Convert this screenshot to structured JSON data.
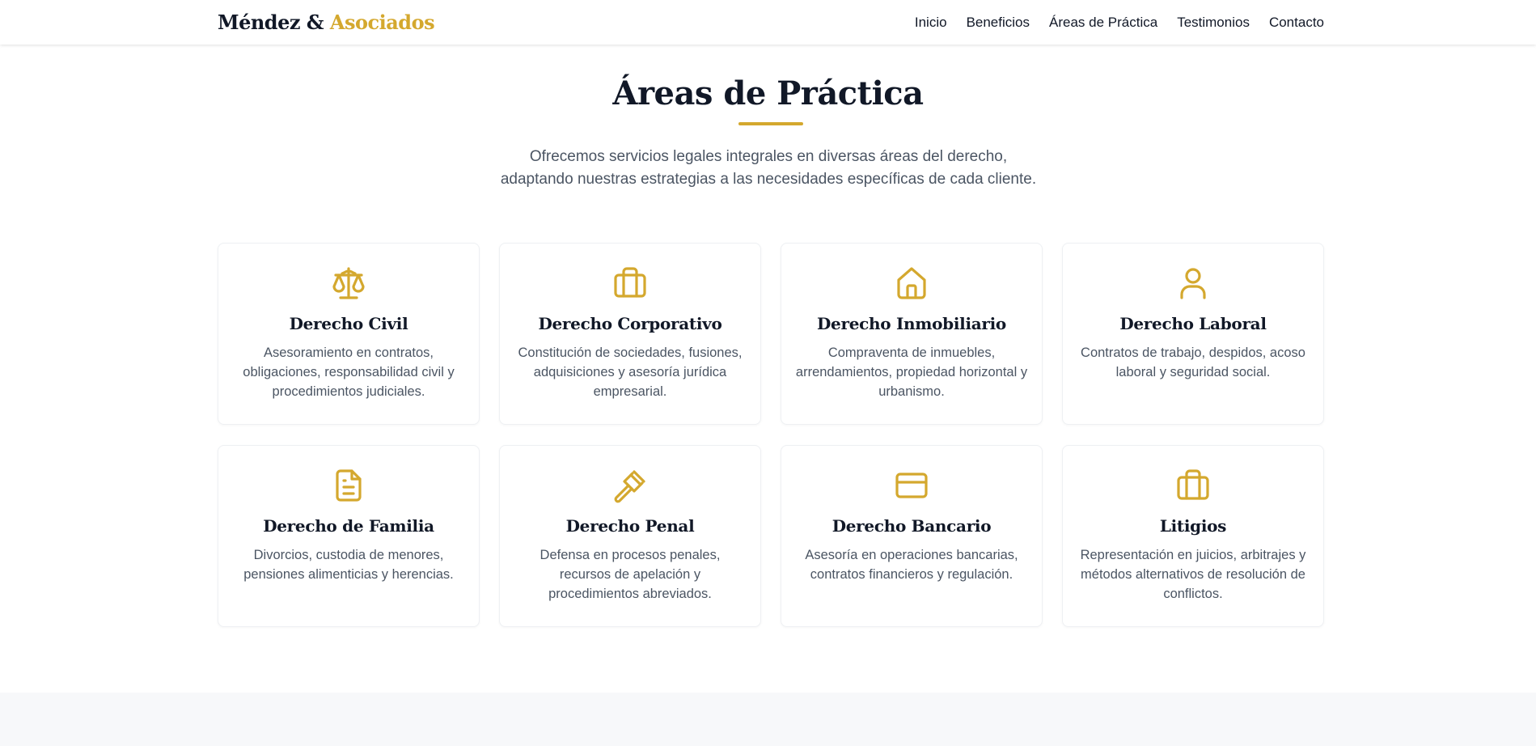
{
  "brand": {
    "name_part1": "Méndez &",
    "name_part2": "Asociados"
  },
  "nav": {
    "items": [
      "Inicio",
      "Beneficios",
      "Áreas de Práctica",
      "Testimonios",
      "Contacto"
    ]
  },
  "section": {
    "title": "Áreas de Práctica",
    "description_line1": "Ofrecemos servicios legales integrales en diversas áreas del derecho,",
    "description_line2": "adaptando nuestras estrategias a las necesidades específicas de cada cliente."
  },
  "colors": {
    "accent": "#d4a82e",
    "heading": "#111827",
    "body_text": "#4b5563"
  },
  "cards": [
    {
      "icon": "scale-icon",
      "title": "Derecho Civil",
      "text": "Asesoramiento en contratos, obligaciones, responsabilidad civil y procedimientos judiciales."
    },
    {
      "icon": "briefcase-icon",
      "title": "Derecho Corporativo",
      "text": "Constitución de sociedades, fusiones, adquisiciones y asesoría jurídica empresarial."
    },
    {
      "icon": "home-icon",
      "title": "Derecho Inmobiliario",
      "text": "Compraventa de inmuebles, arrendamientos, propiedad horizontal y urbanismo."
    },
    {
      "icon": "user-icon",
      "title": "Derecho Laboral",
      "text": "Contratos de trabajo, despidos, acoso laboral y seguridad social."
    },
    {
      "icon": "document-icon",
      "title": "Derecho de Familia",
      "text": "Divorcios, custodia de menores, pensiones alimenticias y herencias."
    },
    {
      "icon": "gavel-icon",
      "title": "Derecho Penal",
      "text": "Defensa en procesos penales, recursos de apelación y procedimientos abreviados."
    },
    {
      "icon": "credit-card-icon",
      "title": "Derecho Bancario",
      "text": "Asesoría en operaciones bancarias, contratos financieros y regulación."
    },
    {
      "icon": "briefcase-icon",
      "title": "Litigios",
      "text": "Representación en juicios, arbitrajes y métodos alternativos de resolución de conflictos."
    }
  ]
}
